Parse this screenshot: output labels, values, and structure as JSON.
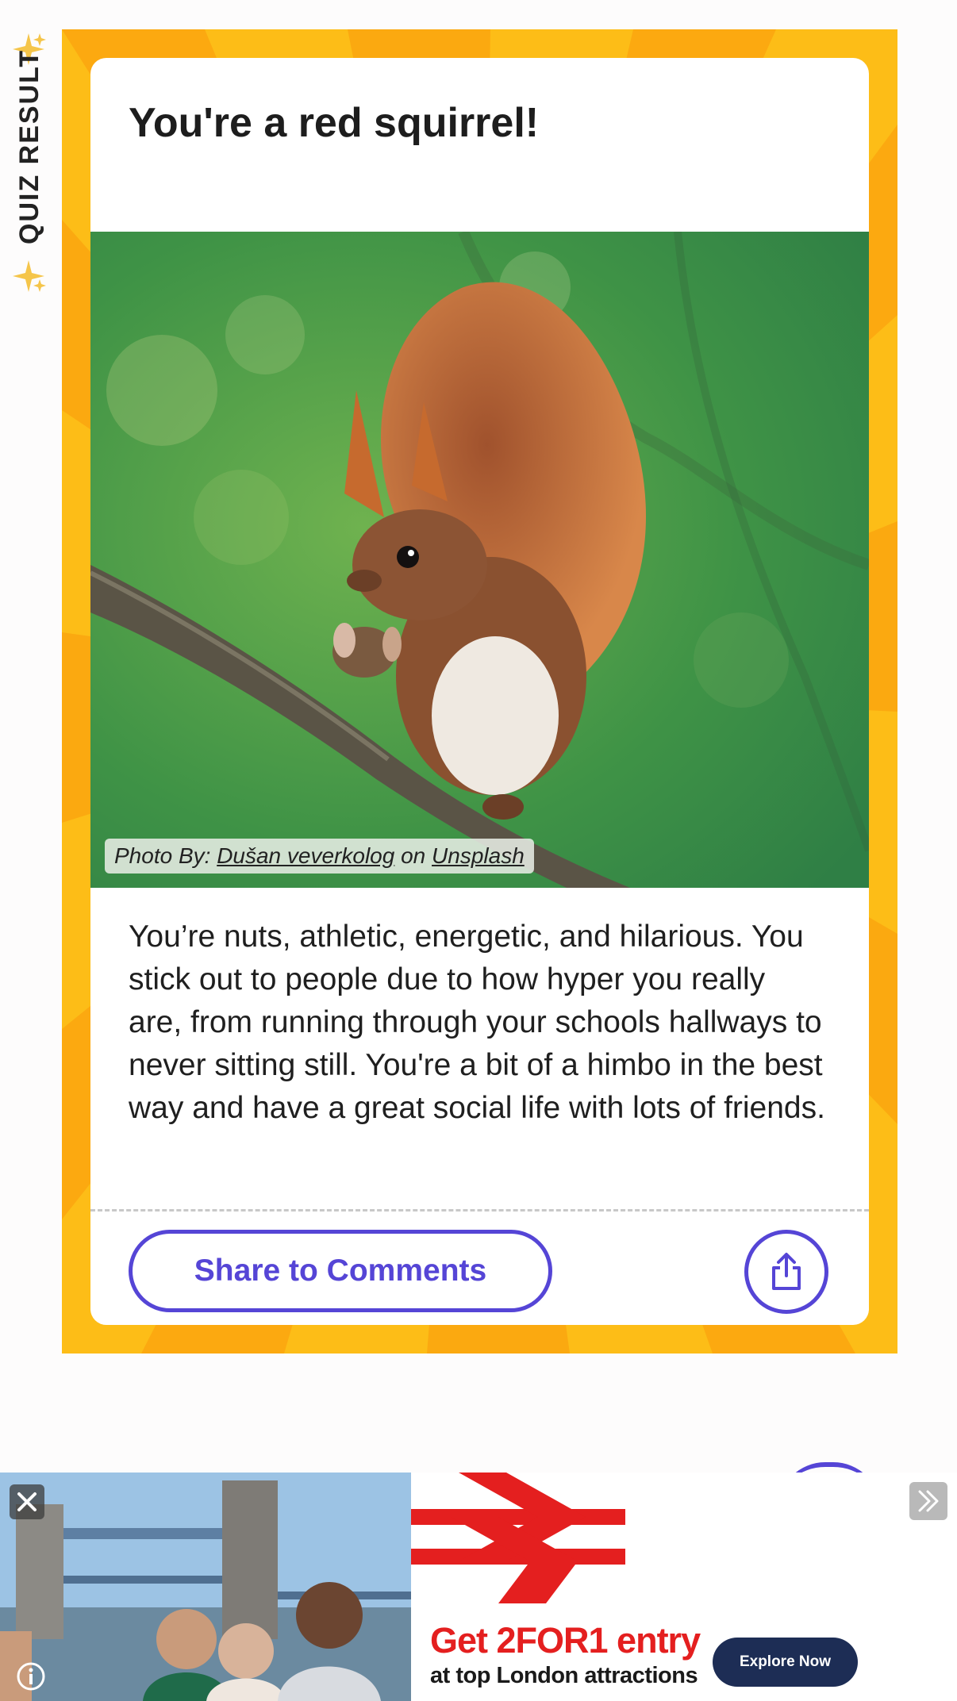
{
  "side_label": {
    "text": "QUIZ RESULT",
    "icon": "sparkles-icon"
  },
  "result": {
    "title": "You're a red squirrel!",
    "image_alt": "Red squirrel eating a nut on a branch",
    "credit": {
      "prefix": "Photo By:",
      "author": "Dušan veverkolog",
      "joiner": "on",
      "source": "Unsplash"
    },
    "description": "You’re nuts, athletic, energetic, and hilarious. You stick out to people due to how hyper you really are, from running through your schools hallways to never sitting still. You're a bit of a himbo in the best way and have a great social life with lots of friends."
  },
  "actions": {
    "share_comments_label": "Share to Comments",
    "share_icon": "share-icon"
  },
  "ad": {
    "headline": "Get 2FOR1 entry",
    "subline": "at top London attractions",
    "cta_label": "Explore Now",
    "close_icon": "close-icon",
    "info_icon": "info-icon",
    "next_icon": "double-chevron-right-icon"
  },
  "colors": {
    "accent": "#5545d6",
    "frame_yellow": "#fdbd17",
    "frame_orange": "#fba60f",
    "ad_red": "#e41f1f",
    "ad_navy": "#1d2d55"
  }
}
